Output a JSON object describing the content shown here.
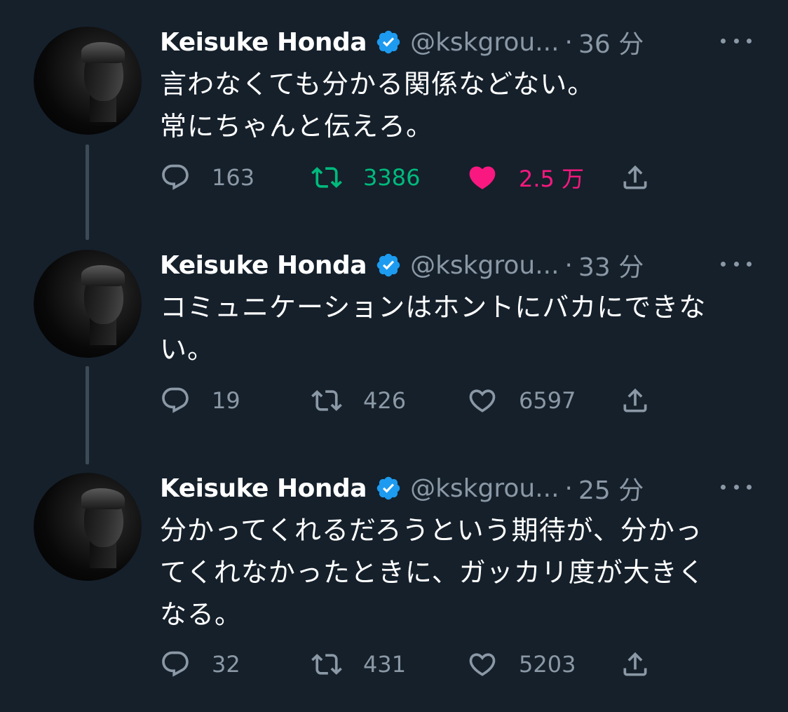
{
  "colors": {
    "background": "#15202b",
    "secondary_text": "#8b98a5",
    "verified": "#1d9bf0",
    "retweet_active": "#00ba7c",
    "like_active": "#f91880"
  },
  "tweets": [
    {
      "name": "Keisuke Honda",
      "handle": "@kskgrou...",
      "separator": "·",
      "time": "36 分",
      "lines": [
        "言わなくても分かる関係などない。",
        "常にちゃんと伝えろ。"
      ],
      "replies": "163",
      "retweets": "3386",
      "likes": "2.5 万",
      "retweeted": true,
      "liked": true
    },
    {
      "name": "Keisuke Honda",
      "handle": "@kskgrou...",
      "separator": "·",
      "time": "33 分",
      "lines": [
        "コミュニケーションはホントにバカにできな",
        "い。"
      ],
      "replies": "19",
      "retweets": "426",
      "likes": "6597",
      "retweeted": false,
      "liked": false
    },
    {
      "name": "Keisuke Honda",
      "handle": "@kskgrou...",
      "separator": "·",
      "time": "25 分",
      "lines": [
        "分かってくれるだろうという期待が、分かっ",
        "てくれなかったときに、ガッカリ度が大きく",
        "なる。"
      ],
      "replies": "32",
      "retweets": "431",
      "likes": "5203",
      "retweeted": false,
      "liked": false
    }
  ]
}
